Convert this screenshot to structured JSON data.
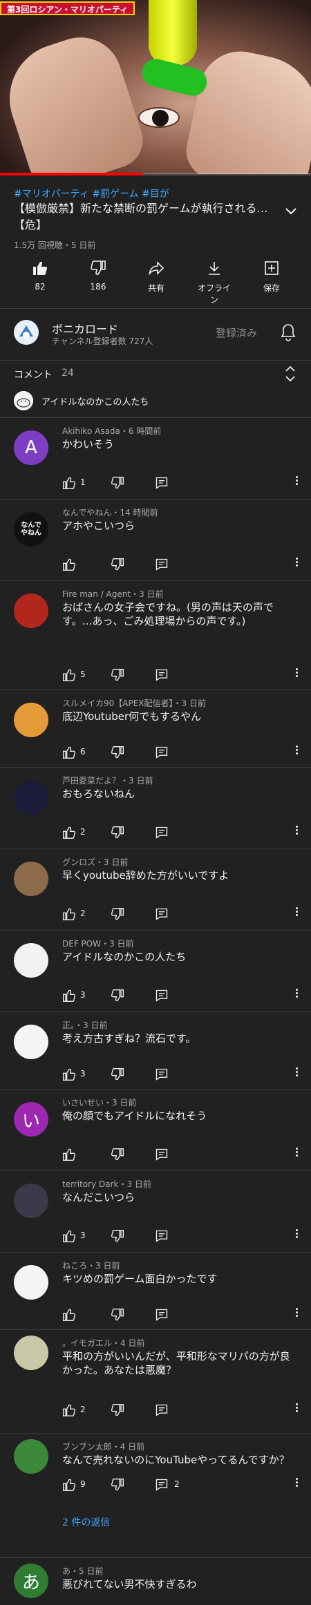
{
  "video": {
    "thumbnail_badge": "第3回ロシアン・マリオパーティ",
    "progress": 0.46,
    "tags": "#マリオパーティ #罰ゲーム #目が",
    "title": "【模倣厳禁】新たな禁断の罰ゲームが執行される…【危】",
    "meta": "1.5万 回視聴・5 日前",
    "actions": [
      {
        "icon": "thumbs-up-icon",
        "label": "82"
      },
      {
        "icon": "thumbs-down-icon",
        "label": "186"
      },
      {
        "icon": "share-icon",
        "label": "共有"
      },
      {
        "icon": "download-icon",
        "label": "オフライン"
      },
      {
        "icon": "save-playlist-icon",
        "label": "保存"
      }
    ]
  },
  "channel": {
    "name": "ボニカロード",
    "subscribers": "チャンネル登録者数 727人",
    "subscribe_label": "登録済み"
  },
  "comments_header": {
    "label": "コメント",
    "count": "24",
    "pinned_preview": "アイドルなのかこの人たち"
  },
  "colors": {
    "background": "#212121",
    "accent_link": "#3ea6ff",
    "progress_red": "#ff0000",
    "secondary_text": "#aaaaaa"
  },
  "comments": [
    {
      "author": "Akihiko Asada・6 時間前",
      "text": "かわいそう",
      "likes": "1",
      "replies": "",
      "avatar_letter": "A",
      "avatar_color": "#7e3ec3"
    },
    {
      "author": "なんでやねん・14 時間前",
      "text": "アホやこいつら",
      "likes": "",
      "replies": "",
      "avatar_letter": "なんでやねん",
      "avatar_color": "#111111"
    },
    {
      "author": "Fire man / Agent・3 日前",
      "text": "おばさんの女子会ですね。(男の声は天の声です。…あっ、ごみ処理場からの声です。)",
      "likes": "5",
      "replies": "",
      "avatar_letter": "",
      "avatar_color": "#b3261e"
    },
    {
      "author": "スルメイカ90【APEX配信者】・3 日前",
      "text": "底辺Youtuber何でもするやん",
      "likes": "6",
      "replies": "",
      "avatar_letter": "",
      "avatar_color": "#e59a3a"
    },
    {
      "author": "芦田愛菜だよ？・3 日前",
      "text": "おもろないねん",
      "likes": "2",
      "replies": "",
      "avatar_letter": "",
      "avatar_color": "#1b1b3a"
    },
    {
      "author": "グンロズ・3 日前",
      "text": "早くyoutube辞めた方がいいですよ",
      "likes": "2",
      "replies": "",
      "avatar_letter": "",
      "avatar_color": "#8c6a4a"
    },
    {
      "author": "DEF POW・3 日前",
      "text": "アイドルなのかこの人たち",
      "likes": "3",
      "replies": "",
      "avatar_letter": "",
      "avatar_color": "#f2f2f2"
    },
    {
      "author": "正。・3 日前",
      "text": "考え方古すぎね？流石です。",
      "likes": "3",
      "replies": "",
      "avatar_letter": "",
      "avatar_color": "#f5f5f5"
    },
    {
      "author": "いさいせい・3 日前",
      "text": "俺の顔でもアイドルになれそう",
      "likes": "",
      "replies": "",
      "avatar_letter": "い",
      "avatar_color": "#9c27b0"
    },
    {
      "author": "territory Dark・3 日前",
      "text": "なんだこいつら",
      "likes": "3",
      "replies": "",
      "avatar_letter": "",
      "avatar_color": "#3a3a4a"
    },
    {
      "author": "ねころ・3 日前",
      "text": "キツめの罰ゲーム面白かったです",
      "likes": "",
      "replies": "",
      "avatar_letter": "",
      "avatar_color": "#f5f5f5"
    },
    {
      "author": "。イモガエル・4 日前",
      "text": "平和の方がいいんだが、平和形なマリパの方が良かった。あなたは悪魔？",
      "likes": "2",
      "replies": "",
      "avatar_letter": "",
      "avatar_color": "#c9c9a9"
    },
    {
      "author": "ブンブン太郎・4 日前",
      "text": "なんで売れないのにYouTubeやってるんですか？",
      "likes": "9",
      "replies": "2",
      "avatar_letter": "",
      "avatar_color": "#3a8a3a"
    },
    {
      "author": "あ・5 日前",
      "text": "悪びれてない男不快すぎるわ",
      "likes": "",
      "replies": "",
      "avatar_letter": "あ",
      "avatar_color": "#2e7d32"
    }
  ],
  "reply_link": "2 件の返信"
}
